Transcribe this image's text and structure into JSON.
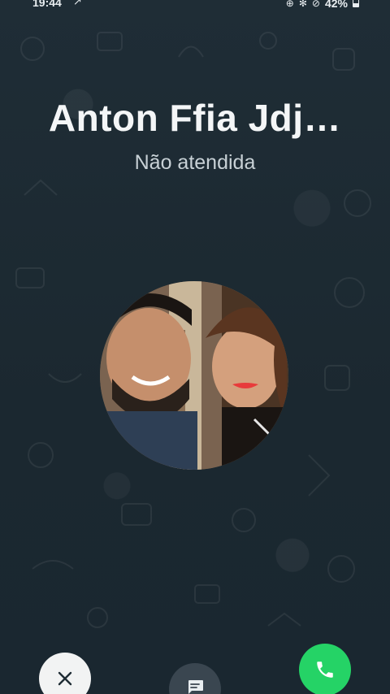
{
  "status_bar": {
    "time": "19:44",
    "battery_text": "42%",
    "battery_level": 0.42,
    "icons": [
      "navigation-arrow-icon",
      "game-controller-icon",
      "wifi-off-icon",
      "do-not-disturb-icon",
      "battery-icon"
    ]
  },
  "call": {
    "caller_name": "Anton Ffia Jdj…",
    "status": "Não atendida"
  },
  "actions": {
    "decline_icon": "close-icon",
    "message_icon": "message-icon",
    "callback_icon": "phone-icon"
  },
  "colors": {
    "background": "#1c2a33",
    "callback_green": "#25d366",
    "decline_white": "#f2f3f3",
    "message_gray": "#3a4650"
  }
}
